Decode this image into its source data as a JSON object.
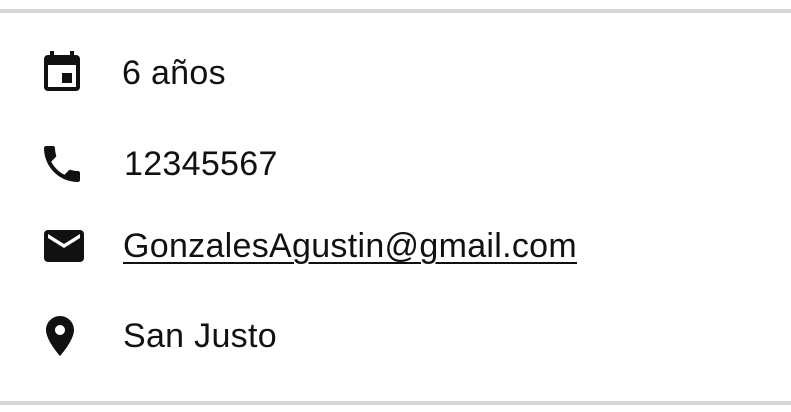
{
  "contact_info": {
    "age": {
      "icon": "calendar-icon",
      "text": "6 años"
    },
    "phone": {
      "icon": "phone-icon",
      "text": "12345567"
    },
    "email": {
      "icon": "mail-icon",
      "text": "GonzalesAgustin@gmail.com"
    },
    "location": {
      "icon": "location-pin-icon",
      "text": "San Justo"
    }
  }
}
